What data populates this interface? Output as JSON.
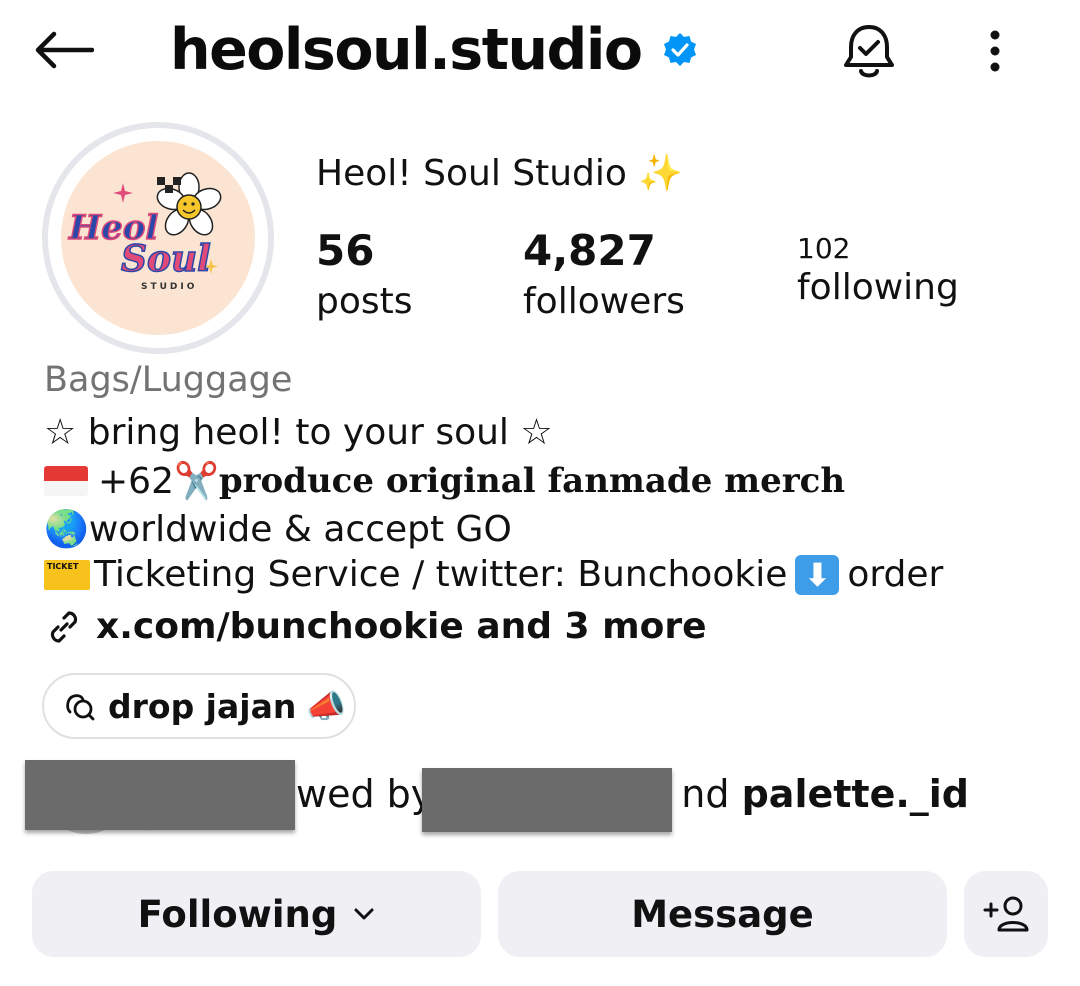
{
  "header": {
    "username": "heolsoul.studio",
    "back_icon": "arrow-left-icon",
    "verified_icon": "verified-badge-icon",
    "notification_icon": "bell-check-icon",
    "more_icon": "more-vertical-icon"
  },
  "profile": {
    "avatar_text_line1": "Heol",
    "avatar_text_line2": "Soul",
    "avatar_text_line3": "STUDIO",
    "display_name": "Heol! Soul Studio",
    "display_name_emoji": "✨",
    "stats": {
      "posts_count": "56",
      "posts_label": "posts",
      "followers_count": "4,827",
      "followers_label": "followers",
      "following_count": "102",
      "following_label": "following"
    }
  },
  "bio": {
    "category": "Bags/Luggage",
    "line1": "☆ bring heol! to your soul ☆",
    "line2_prefix": "+62",
    "line2_emoji": "✂️",
    "line2_bold": "produce original fanmade merch",
    "line3_emoji": "🌏",
    "line3_text": "worldwide & accept GO",
    "line4_ticket_label": "TICKET",
    "line4_text": "Ticketing Service / twitter: Bunchookie",
    "line4_arrow": "⬇",
    "line4_suffix": "order",
    "link_text": "x.com/bunchookie and 3 more"
  },
  "chip": {
    "label": "drop jajan",
    "emoji": "📣"
  },
  "followed_by": {
    "text_fragment_1": "wed by",
    "text_fragment_2": "nd",
    "account": "palette._id"
  },
  "actions": {
    "following_label": "Following",
    "message_label": "Message",
    "add_person_icon": "person-add-icon"
  },
  "colors": {
    "verified_blue": "#0095f6",
    "category_gray": "#737373",
    "button_bg": "#efeff4",
    "avatar_bg": "#fbe5d2"
  }
}
